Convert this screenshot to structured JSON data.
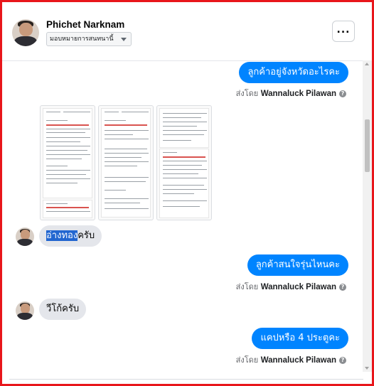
{
  "header": {
    "name": "Phichet Narknam",
    "assign_label": "มอบหมายการสนทนานี้",
    "more_label": "..."
  },
  "messages": {
    "out1": "ลูกค้าอยู่จังหวัดอะไรคะ",
    "sent_prefix": "ส่งโดย",
    "sender_name": "Wannaluck Pilawan",
    "info_glyph": "?",
    "in1_selected": "อ่างทอง",
    "in1_rest": "ครับ",
    "out2": "ลูกค้าสนใจรุ่นไหนคะ",
    "in2": "วีโก้ครับ",
    "out3": "แคปหรือ 4 ประตูคะ"
  },
  "colors": {
    "accent": "#0084ff",
    "frame": "#e8161b",
    "incoming_bubble": "#e4e6eb",
    "selection": "#2266d0"
  }
}
